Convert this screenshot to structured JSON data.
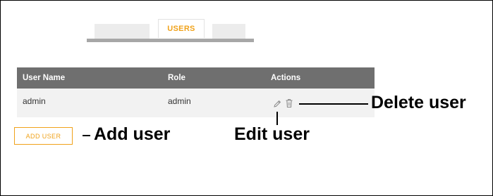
{
  "tabs": {
    "active_label": "USERS"
  },
  "table": {
    "columns": [
      "User Name",
      "Role",
      "Actions"
    ],
    "rows": [
      {
        "user_name": "admin",
        "role": "admin"
      }
    ]
  },
  "add_user_button": {
    "label": "ADD USER"
  },
  "annotations": {
    "delete_user": "Delete user",
    "add_user": "Add user",
    "edit_user": "Edit user"
  },
  "colors": {
    "accent": "#f0a21a",
    "header_bg": "#6f6f6f",
    "row_bg": "#f2f2f2"
  },
  "icons": [
    "pencil-icon",
    "trash-icon"
  ]
}
